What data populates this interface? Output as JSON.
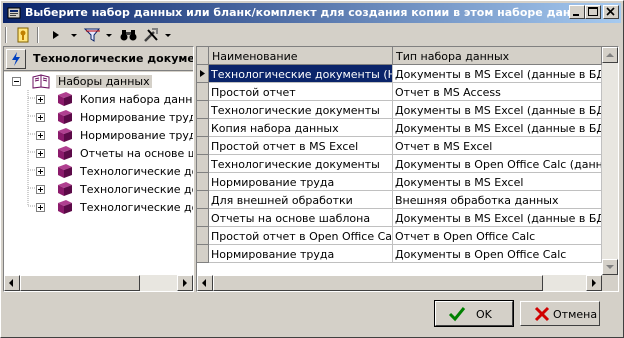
{
  "window": {
    "title": "Выберите набор данных или бланк/комплект для создания копии в этом наборе данных"
  },
  "toolbar": {
    "icons": [
      "key-icon",
      "play-icon",
      "filter-icon",
      "binoculars-icon",
      "tools-icon"
    ]
  },
  "left_panel": {
    "title": "Технологические документы",
    "tree": {
      "root": "Наборы данных",
      "items": [
        {
          "label": "Копия набора данных"
        },
        {
          "label": "Нормирование труда"
        },
        {
          "label": "Нормирование труда"
        },
        {
          "label": "Отчеты на основе шаблона"
        },
        {
          "label": "Технологические документы"
        },
        {
          "label": "Технологические документы"
        },
        {
          "label": "Технологические документы"
        }
      ]
    }
  },
  "grid": {
    "columns": [
      "Наименование",
      "Тип набора данных"
    ],
    "rows": [
      {
        "name": "Технологические документы (НД)",
        "type": "Документы в MS Excel (данные в БД)"
      },
      {
        "name": "Простой отчет",
        "type": "Отчет в MS Access"
      },
      {
        "name": "Технологические документы",
        "type": "Документы в MS Excel (данные в БД)"
      },
      {
        "name": "Копия набора данных",
        "type": "Документы в MS Excel (данные в БД)"
      },
      {
        "name": "Простой отчет в MS Excel",
        "type": "Отчет в MS Excel"
      },
      {
        "name": "Технологические документы",
        "type": "Документы в Open Office Calc (данные в БД)"
      },
      {
        "name": "Нормирование труда",
        "type": "Документы в MS Excel"
      },
      {
        "name": "Для внешней обработки",
        "type": "Внешняя обработка данных"
      },
      {
        "name": "Отчеты на основе шаблона",
        "type": "Документы в MS Excel (данные в БД и шаблон)"
      },
      {
        "name": "Простой отчет в Open Office Calc",
        "type": "Отчет в Open Office Calc"
      },
      {
        "name": "Нормирование труда",
        "type": "Документы в Open Office Calc"
      }
    ],
    "selected_row": 0
  },
  "buttons": {
    "ok": "OK",
    "cancel": "Отмена"
  },
  "colors": {
    "title_bar": "#0a246a",
    "selection": "#0a246a",
    "book_icon": "#8b1a6b"
  }
}
